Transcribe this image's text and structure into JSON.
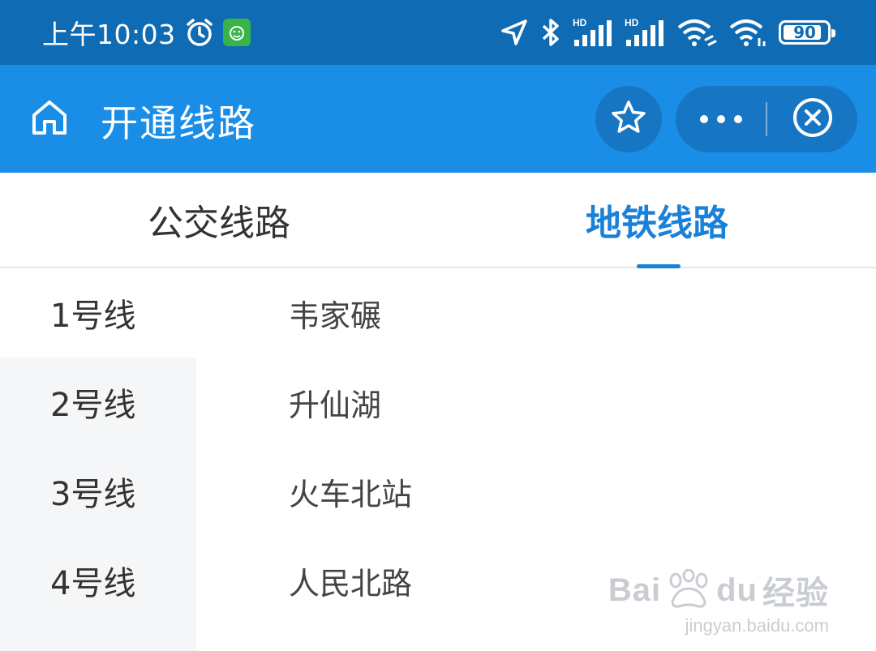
{
  "status_bar": {
    "time": "上午10:03",
    "battery_level": 0.9,
    "battery_text": "90",
    "signal1_label": "HD",
    "signal2_label": "HD"
  },
  "header": {
    "title": "开通线路",
    "icons": [
      "home-icon",
      "star-icon",
      "more-icon",
      "close-icon"
    ]
  },
  "tabs": [
    {
      "label": "公交线路",
      "active": false
    },
    {
      "label": "地铁线路",
      "active": true
    }
  ],
  "lines": [
    {
      "label": "1号线"
    },
    {
      "label": "2号线"
    },
    {
      "label": "3号线"
    },
    {
      "label": "4号线"
    }
  ],
  "stations": [
    {
      "label": "韦家碾"
    },
    {
      "label": "升仙湖"
    },
    {
      "label": "火车北站"
    },
    {
      "label": "人民北路"
    }
  ],
  "watermark": {
    "brand": "Bai",
    "brand_suffix": "du",
    "product": "经验",
    "site": "jingyan.baidu.com"
  },
  "colors": {
    "status_bar_bg": "#0f6bb3",
    "title_bar_bg": "#1a8ee6",
    "accent": "#1a80d8",
    "sidebar_bg": "#f5f6f8"
  }
}
